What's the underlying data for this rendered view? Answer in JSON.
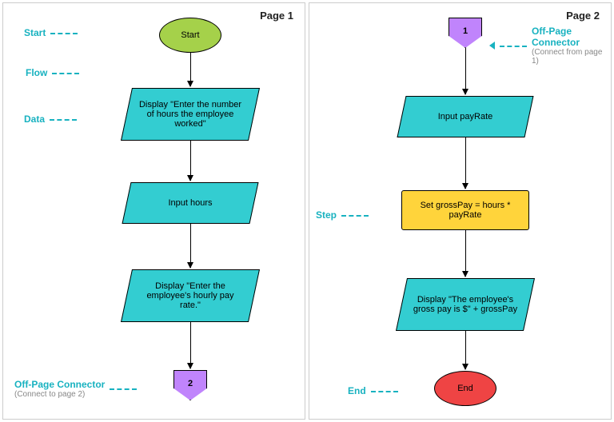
{
  "page1": {
    "title": "Page 1",
    "annotations": {
      "start": "Start",
      "flow": "Flow",
      "data": "Data",
      "offpage_label": "Off-Page Connector",
      "offpage_sub": "(Connect to page 2)"
    },
    "shapes": {
      "start": "Start",
      "data1": "Display \"Enter the number of hours the employee worked\"",
      "data2": "Input hours",
      "data3": "Display \"Enter the employee's hourly pay rate.\"",
      "connector": "2"
    }
  },
  "page2": {
    "title": "Page 2",
    "annotations": {
      "offpage_label": "Off-Page Connector",
      "offpage_sub": "(Connect from page 1)",
      "step": "Step",
      "end": "End"
    },
    "shapes": {
      "connector": "1",
      "data1": "Input payRate",
      "process": "Set grossPay = hours * payRate",
      "data2": "Display \"The employee's gross pay is $\" + grossPay",
      "end": "End"
    }
  },
  "colors": {
    "accent": "#18b2c0",
    "start_fill": "#a5d14a",
    "data_fill": "#33cdd1",
    "process_fill": "#ffd43b",
    "connector_fill": "#c084fc",
    "end_fill": "#ef4444"
  }
}
